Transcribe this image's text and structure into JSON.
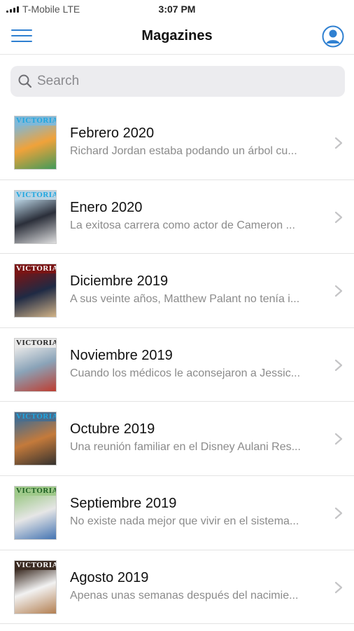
{
  "status_bar": {
    "carrier": "T-Mobile  LTE",
    "time": "3:07 PM"
  },
  "nav": {
    "title": "Magazines",
    "menu_icon": "hamburger-menu-icon",
    "profile_icon": "user-profile-icon"
  },
  "search": {
    "placeholder": "Search",
    "value": "",
    "icon": "search-icon"
  },
  "colors": {
    "accent": "#2f80d1",
    "search_bg": "#ececef",
    "subtitle": "#8b8b8b",
    "separator": "#e3e3e3"
  },
  "magazines": [
    {
      "title": "Febrero 2020",
      "subtitle": "Richard Jordan estaba podando un árbol cu...",
      "cover_title": "VICTORIA",
      "cover_title_color": "#1ea6e0",
      "cover_colors": [
        "#7fb8d8",
        "#f0a23a",
        "#3a9a5b"
      ]
    },
    {
      "title": "Enero 2020",
      "subtitle": "La exitosa carrera como actor de Cameron ...",
      "cover_title": "VICTORIA",
      "cover_title_color": "#1ea6e0",
      "cover_colors": [
        "#b9d3e3",
        "#2b2f3a",
        "#e6e6e6"
      ]
    },
    {
      "title": "Diciembre 2019",
      "subtitle": "A sus veinte años, Matthew Palant no tenía i...",
      "cover_title": "VICTORIA",
      "cover_title_color": "#ffffff",
      "cover_colors": [
        "#7a1414",
        "#1f2a44",
        "#d9b98a"
      ]
    },
    {
      "title": "Noviembre 2019",
      "subtitle": "Cuando los médicos le aconsejaron a Jessic...",
      "cover_title": "VICTORIA",
      "cover_title_color": "#222222",
      "cover_colors": [
        "#e8e8e8",
        "#8aa3b8",
        "#c0392b"
      ]
    },
    {
      "title": "Octubre 2019",
      "subtitle": "Una reunión familiar en el Disney Aulani Res...",
      "cover_title": "VICTORIA",
      "cover_title_color": "#1ea6e0",
      "cover_colors": [
        "#4a6d8c",
        "#c47a3b",
        "#2e2e2e"
      ]
    },
    {
      "title": "Septiembre 2019",
      "subtitle": "No existe nada mejor que vivir en el sistema...",
      "cover_title": "VICTORIA",
      "cover_title_color": "#1b5e20",
      "cover_colors": [
        "#9fc98a",
        "#e6e6e6",
        "#3d6fb0"
      ]
    },
    {
      "title": "Agosto 2019",
      "subtitle": "Apenas unas semanas después del nacimie...",
      "cover_title": "VICTORIA",
      "cover_title_color": "#ffffff",
      "cover_colors": [
        "#3b2b22",
        "#f2f2f2",
        "#b07a4a"
      ]
    }
  ]
}
